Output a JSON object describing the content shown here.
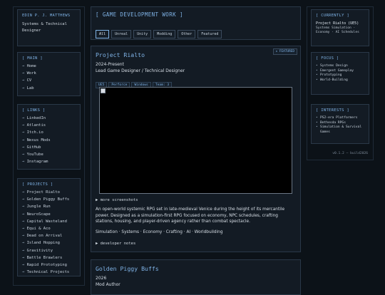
{
  "profile": {
    "name": "EDIN P. J. MATTHEWS",
    "subtitle": "Systems & Technical Designer"
  },
  "main_nav": {
    "heading": "[ MAIN ]",
    "items": [
      "Home",
      "Work",
      "CV",
      "Lab"
    ]
  },
  "links_nav": {
    "heading": "[ LINKS ]",
    "items": [
      "LinkedIn",
      "Atlantis",
      "Itch.io",
      "Nexus Mods",
      "GitHub",
      "YouTube",
      "Instagram"
    ]
  },
  "projects_nav": {
    "heading": "[ PROJECTS ]",
    "items": [
      "Project Rialto",
      "Golden Piggy Buffs",
      "Jungle Run",
      "NeuroScape",
      "Capital Wasteland",
      "Equi & Aco",
      "Dead on Arrival",
      "Island Hopping",
      "Gravitivity",
      "Battle Brawlers",
      "Rapid Prototyping",
      "Technical Projects"
    ]
  },
  "work": {
    "heading": "[ GAME DEVELOPMENT WORK ]",
    "filters": [
      "All",
      "Unreal",
      "Unity",
      "Modding",
      "Other",
      "Featured"
    ],
    "active_filter": "All"
  },
  "project1": {
    "title": "Project Rialto",
    "badge": "★ FEATURED",
    "dates": "2024-Present",
    "role": "Lead Game Designer / Technical Designer",
    "tags": [
      "UE5",
      "Perforce",
      "Windows",
      "Team: 3"
    ],
    "more_screens": "▶ more screenshots",
    "description": "An open-world systemic RPG set in late-medieval Venice during the height of its mercantile power. Designed as a simulation-first RPG focused on economy, NPC schedules, crafting stations, housing, and player-driven agency rather than combat spectacle.",
    "keywords": "Simulation · Systems · Economy · Crafting · AI · Worldbuilding",
    "dev_notes": "▶ developer notes"
  },
  "project2": {
    "title": "Golden Piggy Buffs",
    "dates": "2026",
    "role": "Mod Author"
  },
  "currently": {
    "heading": "[ CURRENTLY ]",
    "title": "Project Rialto (UE5)",
    "detail": "Systems Simulation · Economy · AI Schedules"
  },
  "focus": {
    "heading": "[ FOCUS ]",
    "items": [
      "Systems Design",
      "Emergent Gameplay",
      "Prototyping",
      "World-Building"
    ]
  },
  "interests": {
    "heading": "[ INTERESTS ]",
    "items": [
      "PS2-era Platformers",
      "Bethesda RPGs",
      "Simulation & Survival Games"
    ]
  },
  "version": "v0.1.2 — build2026",
  "colors": {
    "background": "#0c1218",
    "panel": "#131b24",
    "border": "#2a3848",
    "accent": "#7fb2e5"
  }
}
